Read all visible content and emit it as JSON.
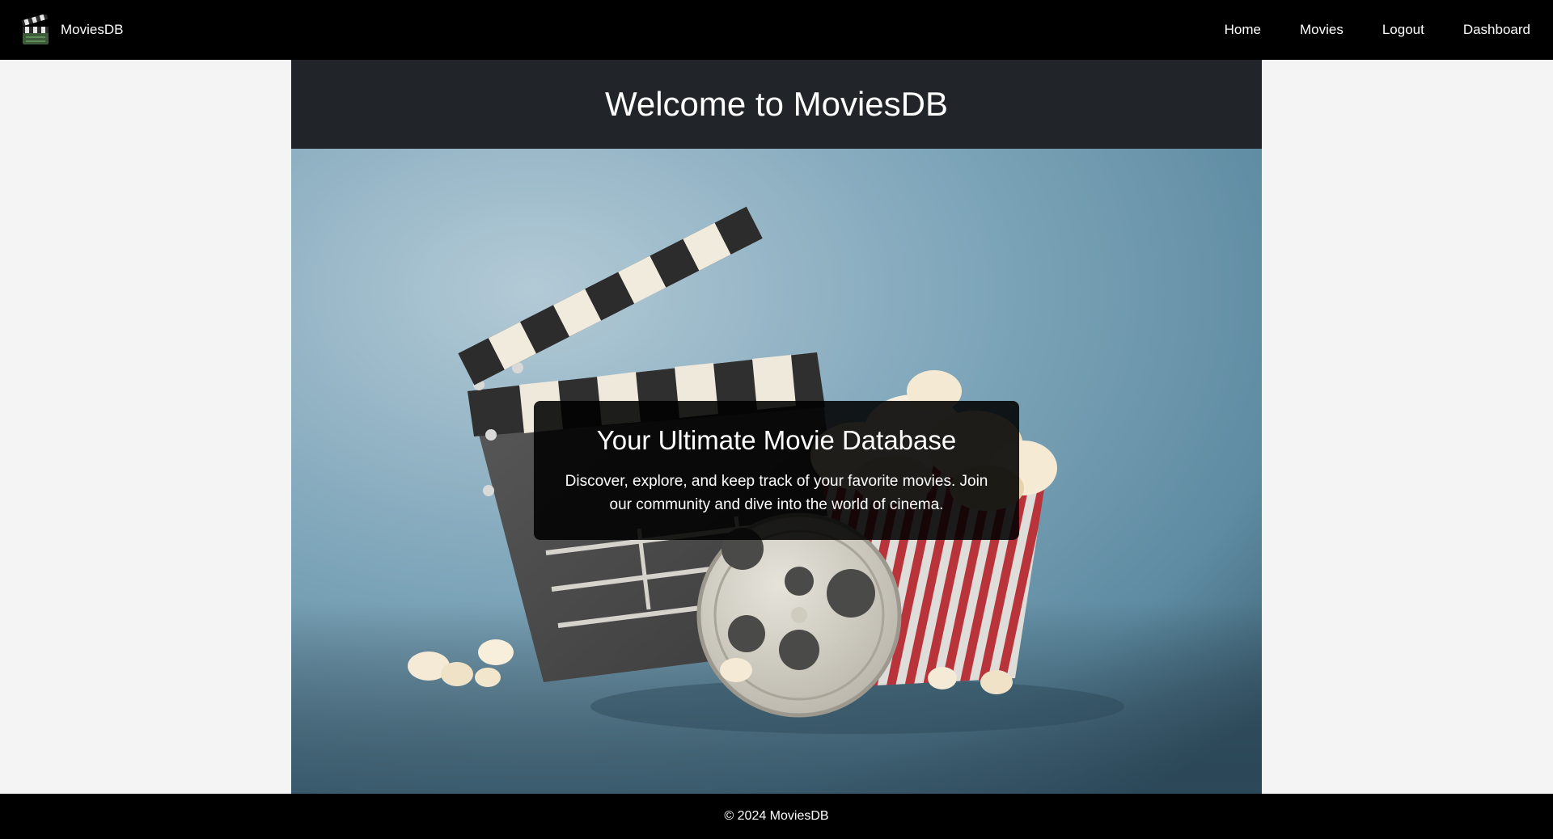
{
  "navbar": {
    "brand": "MoviesDB",
    "brand_icon": "clapperboard-icon",
    "links": [
      {
        "label": "Home"
      },
      {
        "label": "Movies"
      },
      {
        "label": "Logout"
      },
      {
        "label": "Dashboard"
      }
    ]
  },
  "hero": {
    "title": "Welcome to MoviesDB",
    "card_heading": "Your Ultimate Movie Database",
    "card_text": "Discover, explore, and keep track of your favorite movies. Join our community and dive into the world of cinema."
  },
  "footer": {
    "text": "© 2024 MoviesDB"
  },
  "colors": {
    "navbar_bg": "#000000",
    "title_bar_bg": "#212529",
    "page_bg": "#f4f4f4",
    "hero_backdrop": "#7aa3b8",
    "card_bg": "rgba(0,0,0,0.88)"
  }
}
